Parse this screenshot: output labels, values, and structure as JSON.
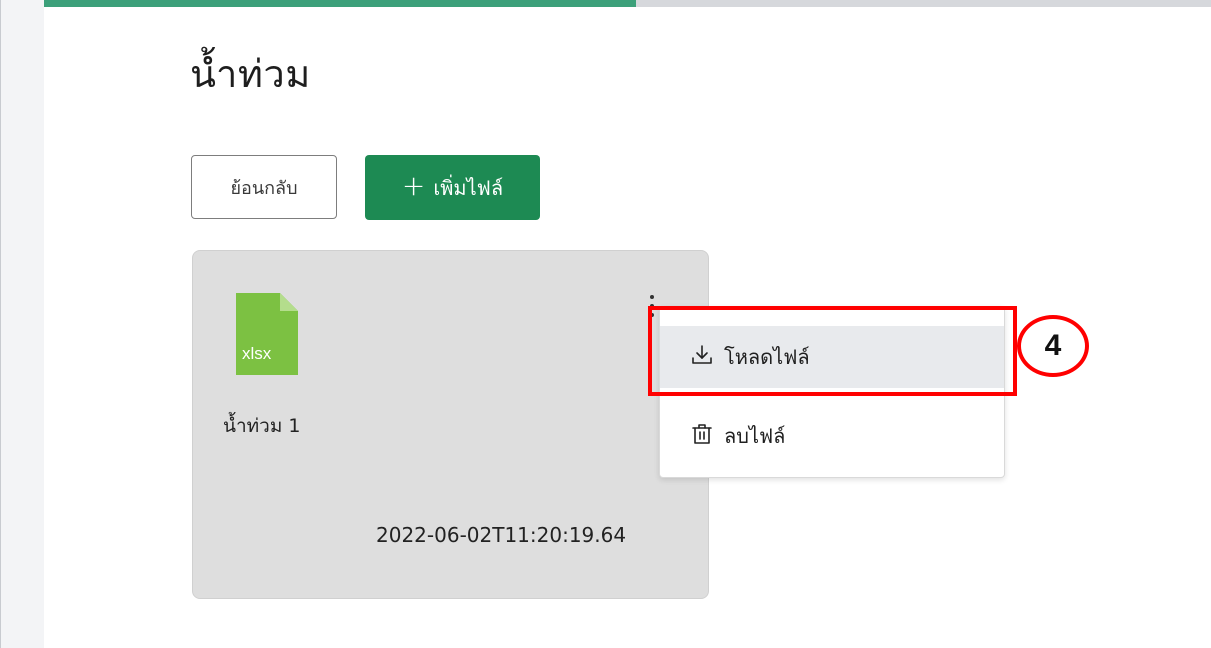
{
  "progress": {
    "fraction": 0.525,
    "fill_color": "#3ca07a",
    "track_color": "#d6d8dc"
  },
  "page": {
    "title": "น้ำท่วม"
  },
  "toolbar": {
    "back_label": "ย้อนกลับ",
    "add_icon": "plus-icon",
    "add_symbol": "+",
    "add_label": "เพิ่มไฟล์",
    "add_color": "#1d8a53"
  },
  "file_card": {
    "file_type": "xlsx",
    "file_icon": "xlsx-file-icon",
    "icon_color": "#7cc142",
    "name": "น้ำท่วม 1",
    "date": "2022-06-02T11:20:19.64",
    "menu_icon": "kebab-menu-icon"
  },
  "context_menu": {
    "items": [
      {
        "icon": "download-icon",
        "label": "โหลดไฟล์",
        "highlighted": true
      },
      {
        "icon": "trash-icon",
        "label": "ลบไฟล์",
        "highlighted": false
      }
    ]
  },
  "annotation": {
    "step_number": "4",
    "color": "#ff0000"
  }
}
